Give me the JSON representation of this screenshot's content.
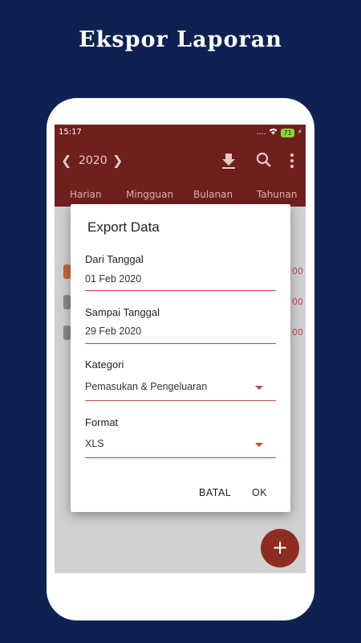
{
  "promo": {
    "title": "Ekspor Laporan"
  },
  "status_bar": {
    "time": "15:17",
    "signal": "....",
    "battery": "71"
  },
  "toolbar": {
    "year": "2020",
    "prev_icon": "chevron-left-icon",
    "next_icon": "chevron-right-icon"
  },
  "tabs": [
    "Harian",
    "Mingguan",
    "Bulanan",
    "Tahunan"
  ],
  "background_list": {
    "values": [
      "00",
      "00",
      "00"
    ]
  },
  "dialog": {
    "title": "Export Data",
    "from_label": "Dari Tanggal",
    "from_value": "01 Feb 2020",
    "to_label": "Sampai Tanggal",
    "to_value": "29 Feb 2020",
    "category_label": "Kategori",
    "category_value": "Pemasukan & Pengeluaran",
    "format_label": "Format",
    "format_value": "XLS",
    "cancel_label": "BATAL",
    "ok_label": "OK"
  },
  "fab": {
    "label": "+"
  },
  "colors": {
    "background": "#0f2150",
    "primary": "#6f1f1d",
    "accent": "#c8463c",
    "fab": "#8e2c22"
  }
}
